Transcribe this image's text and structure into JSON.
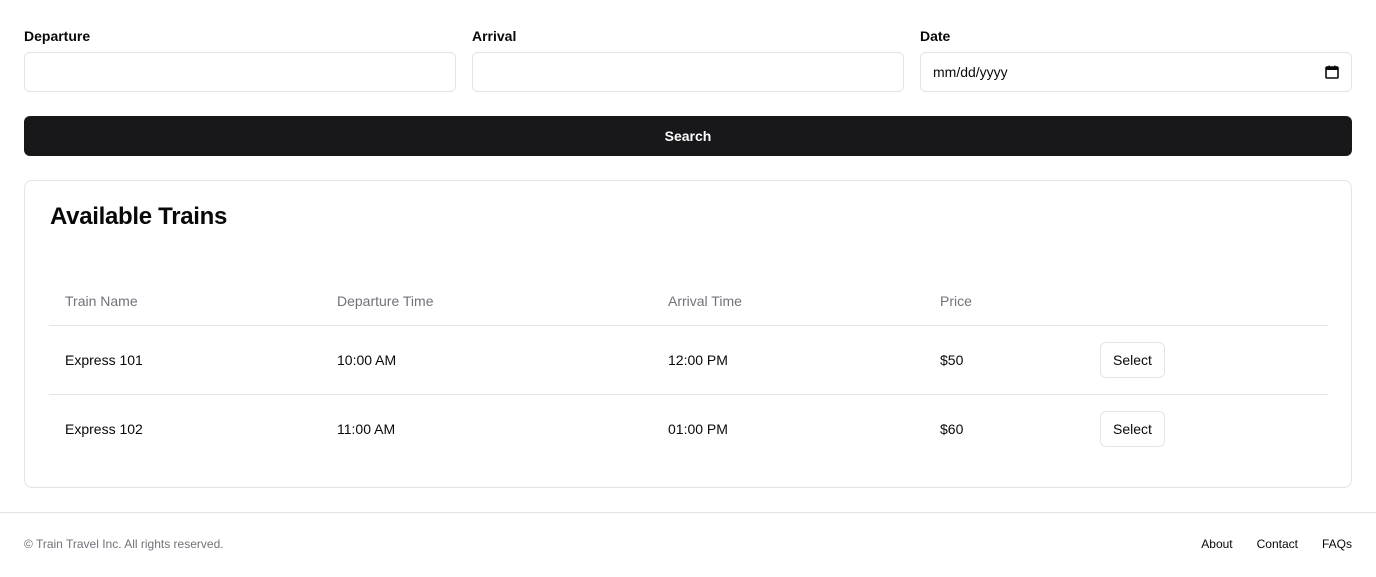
{
  "search": {
    "departure_label": "Departure",
    "departure_value": "",
    "arrival_label": "Arrival",
    "arrival_value": "",
    "date_label": "Date",
    "date_placeholder": "mm/dd/yyyy",
    "date_icon": "calendar-icon",
    "search_label": "Search"
  },
  "results": {
    "title": "Available Trains",
    "columns": [
      "Train Name",
      "Departure Time",
      "Arrival Time",
      "Price",
      ""
    ],
    "rows": [
      {
        "name": "Express 101",
        "departure": "10:00 AM",
        "arrival": "12:00 PM",
        "price": "$50",
        "action": "Select"
      },
      {
        "name": "Express 102",
        "departure": "11:00 AM",
        "arrival": "01:00 PM",
        "price": "$60",
        "action": "Select"
      }
    ]
  },
  "footer": {
    "copyright": "© Train Travel Inc. All rights reserved.",
    "links": [
      "About",
      "Contact",
      "FAQs"
    ]
  },
  "colors": {
    "primary": "#18181b",
    "border": "#e4e4e7",
    "muted_text": "#71717a"
  }
}
